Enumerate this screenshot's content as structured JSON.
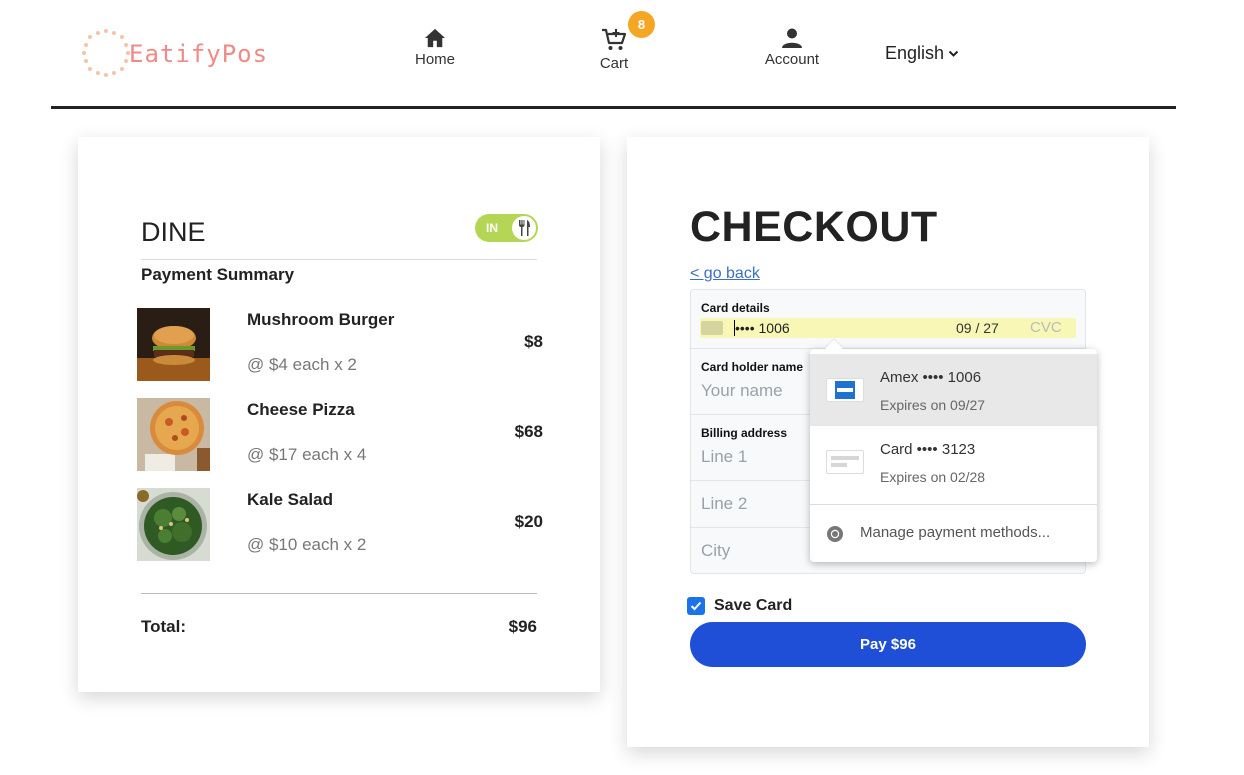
{
  "header": {
    "logo_text": "EatifyPos",
    "nav": {
      "home": "Home",
      "cart": "Cart",
      "account": "Account"
    },
    "cart_count": "8",
    "language": "English"
  },
  "summary": {
    "dine_title": "DINE",
    "dine_toggle_label": "IN",
    "payment_summary": "Payment Summary",
    "items": [
      {
        "name": "Mushroom Burger",
        "price_each": "@ $4 each x 2",
        "total": "$8"
      },
      {
        "name": "Cheese Pizza",
        "price_each": "@ $17 each x 4",
        "total": "$68"
      },
      {
        "name": "Kale Salad",
        "price_each": "@ $10 each x 2",
        "total": "$20"
      }
    ],
    "total_label": "Total:",
    "total_value": "$96"
  },
  "checkout": {
    "title": "CHECKOUT",
    "go_back": "< go back",
    "card_details_label": "Card details",
    "card_number": "•••• 1006",
    "card_expiry": "09 / 27",
    "cvc_placeholder": "CVC",
    "holder_label": "Card holder name",
    "holder_placeholder": "Your name",
    "billing_label": "Billing address",
    "line1_placeholder": "Line 1",
    "line2_placeholder": "Line 2",
    "city_placeholder": "City",
    "save_card_label": "Save Card",
    "save_card_checked": true,
    "pay_button": "Pay $96"
  },
  "autofill": {
    "options": [
      {
        "title": "Amex  •••• 1006",
        "subtitle": "Expires on 09/27",
        "icon": "amex-card-icon"
      },
      {
        "title": "Card  •••• 3123",
        "subtitle": "Expires on 02/28",
        "icon": "generic-card-icon"
      }
    ],
    "manage": "Manage payment methods..."
  },
  "colors": {
    "brand": "#f08a86",
    "badge": "#f5a623",
    "toggle": "#b5d654",
    "pay_button": "#1e4fd6",
    "link": "#3b6fc2",
    "autofill_highlight": "#f9f7b6"
  }
}
